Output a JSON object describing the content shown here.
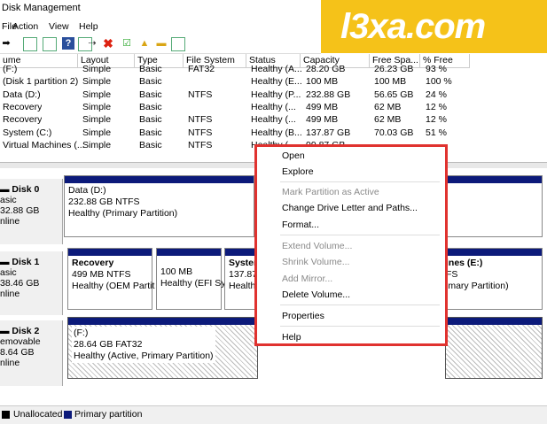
{
  "window": {
    "title": "Disk Management"
  },
  "watermark": "l3xa.com",
  "menu": [
    "File",
    "Action",
    "View",
    "Help"
  ],
  "columns": [
    "ume",
    "Layout",
    "Type",
    "File System",
    "Status",
    "Capacity",
    "Free Spa...",
    "% Free"
  ],
  "volumes": [
    [
      "(F:)",
      "Simple",
      "Basic",
      "FAT32",
      "Healthy (A...",
      "28.20 GB",
      "26.23 GB",
      "93 %"
    ],
    [
      "(Disk 1 partition 2)",
      "Simple",
      "Basic",
      "",
      "Healthy (E...",
      "100 MB",
      "100 MB",
      "100 %"
    ],
    [
      "Data (D:)",
      "Simple",
      "Basic",
      "NTFS",
      "Healthy (P...",
      "232.88 GB",
      "56.65 GB",
      "24 %"
    ],
    [
      "Recovery",
      "Simple",
      "Basic",
      "",
      "Healthy (...",
      "499 MB",
      "62 MB",
      "12 %"
    ],
    [
      "Recovery",
      "Simple",
      "Basic",
      "NTFS",
      "Healthy (...",
      "499 MB",
      "62 MB",
      "12 %"
    ],
    [
      "System (C:)",
      "Simple",
      "Basic",
      "NTFS",
      "Healthy (B...",
      "137.87 GB",
      "70.03 GB",
      "51 %"
    ],
    [
      "Virtual Machines (...",
      "Simple",
      "Basic",
      "NTFS",
      "Healthy (...",
      "99.87 GB",
      "...",
      "..."
    ]
  ],
  "disks": [
    {
      "name": "Disk 0",
      "type": "asic",
      "size": "32.88 GB",
      "state": "nline",
      "partitions": [
        {
          "name": "Data  (D:)",
          "detail": "232.88 GB NTFS",
          "status": "Healthy (Primary Partition)"
        }
      ]
    },
    {
      "name": "Disk 1",
      "type": "asic",
      "size": "38.46 GB",
      "state": "nline",
      "partitions": [
        {
          "name": "Recovery",
          "detail": "499 MB NTFS",
          "status": "Healthy (OEM Partit"
        },
        {
          "name": "",
          "detail": "100 MB",
          "status": "Healthy (EFI Sy"
        },
        {
          "name": "System",
          "detail": "137.87",
          "status": "Health"
        },
        {
          "name": "ines  (E:)",
          "detail": "FS",
          "status": "imary Partition)"
        }
      ]
    },
    {
      "name": "Disk 2",
      "type": "emovable",
      "size": "8.64 GB",
      "state": "nline",
      "partitions": [
        {
          "name": "(F:)",
          "detail": "28.64 GB FAT32",
          "status": "Healthy (Active, Primary Partition)"
        }
      ]
    }
  ],
  "legend": {
    "unallocated": "Unallocated",
    "primary": "Primary partition"
  },
  "context_menu": {
    "items": [
      {
        "label": "Open",
        "enabled": true
      },
      {
        "label": "Explore",
        "enabled": true
      },
      {
        "label": "Mark Partition as Active",
        "enabled": false
      },
      {
        "label": "Change Drive Letter and Paths...",
        "enabled": true
      },
      {
        "label": "Format...",
        "enabled": true
      },
      {
        "label": "Extend Volume...",
        "enabled": false
      },
      {
        "label": "Shrink Volume...",
        "enabled": false
      },
      {
        "label": "Add Mirror...",
        "enabled": false
      },
      {
        "label": "Delete Volume...",
        "enabled": true
      },
      {
        "label": "Properties",
        "enabled": true
      },
      {
        "label": "Help",
        "enabled": true
      }
    ]
  },
  "colors": {
    "primary_partition": "#0c1a7a",
    "highlight_border": "#e0322f",
    "watermark_bg": "#f5c219"
  }
}
